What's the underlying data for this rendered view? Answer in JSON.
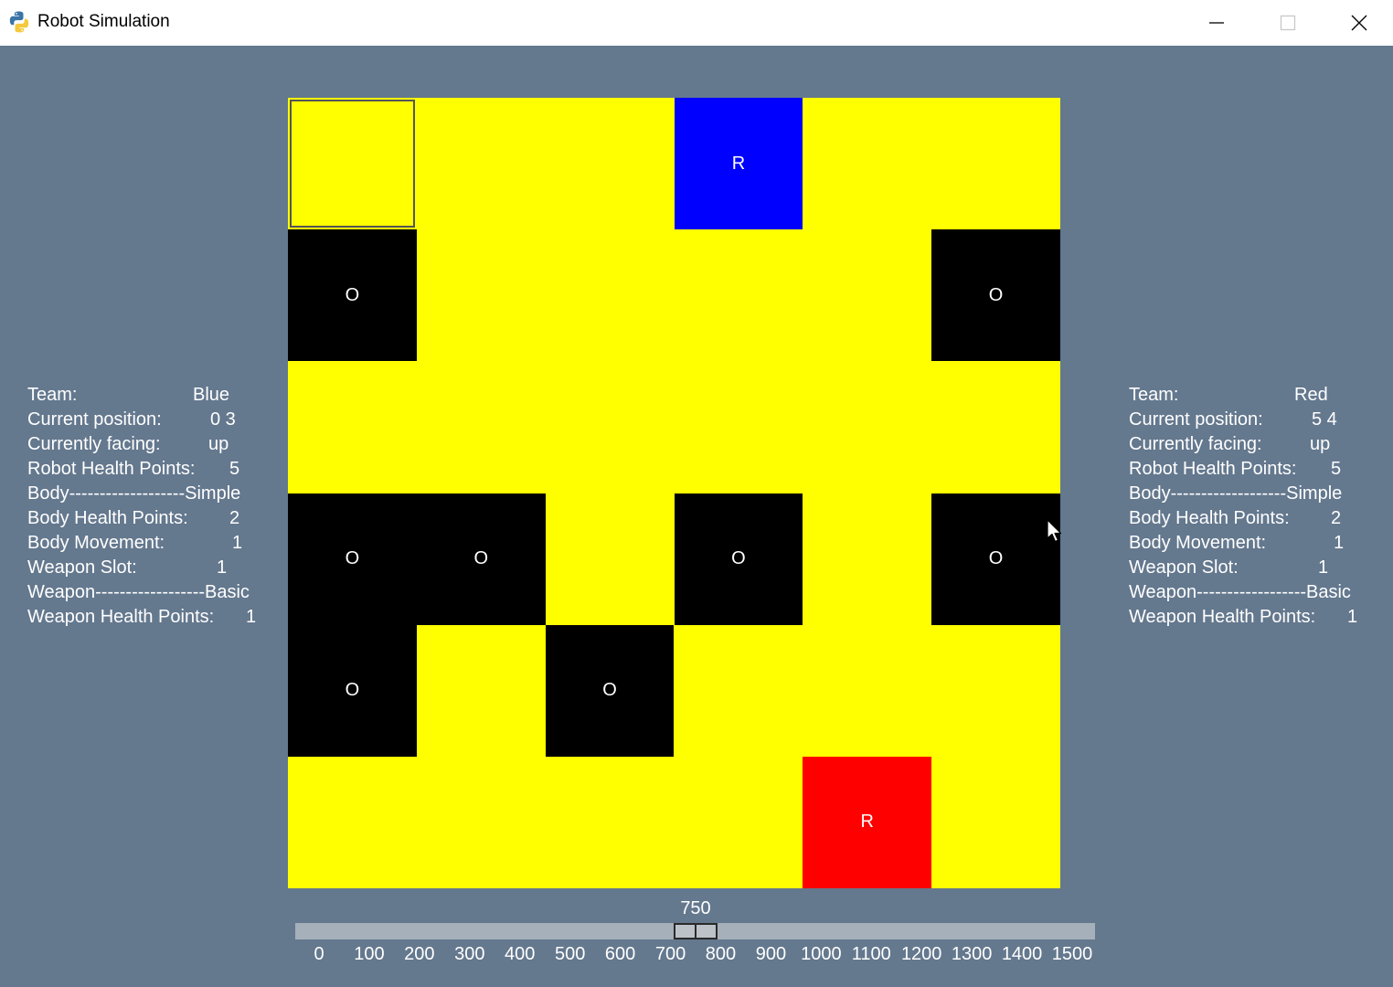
{
  "window": {
    "title": "Robot Simulation",
    "icon": "python-icon",
    "controls": [
      "minimize-icon",
      "maximize-icon",
      "close-icon"
    ]
  },
  "grid": {
    "rows": 6,
    "cols": 6,
    "empty_color": "#ffff00",
    "obstacle_label": "O",
    "robot_label": "R",
    "obstacles": [
      {
        "row": 1,
        "col": 0
      },
      {
        "row": 1,
        "col": 5
      },
      {
        "row": 3,
        "col": 0
      },
      {
        "row": 3,
        "col": 1
      },
      {
        "row": 3,
        "col": 3
      },
      {
        "row": 3,
        "col": 5
      },
      {
        "row": 4,
        "col": 0
      },
      {
        "row": 4,
        "col": 2
      }
    ],
    "robots": [
      {
        "team": "Blue",
        "row": 0,
        "col": 3,
        "color": "#0000ff"
      },
      {
        "team": "Red",
        "row": 5,
        "col": 4,
        "color": "#ff0000"
      }
    ],
    "selected_cell": {
      "row": 0,
      "col": 0
    }
  },
  "left_panel": {
    "team_label": "Team:",
    "team_value": "Blue",
    "position_label": "Current position:",
    "position_value": "0 3",
    "facing_label": "Currently facing:",
    "facing_value": "up",
    "health_label": "Robot Health Points:",
    "health_value": "5",
    "body_label": "Body-------------------Simple",
    "body_health_label": "Body Health Points:",
    "body_health_value": "2",
    "body_movement_label": "Body Movement:",
    "body_movement_value": "1",
    "weapon_slot_label": "Weapon Slot:",
    "weapon_slot_value": "1",
    "weapon_label": "Weapon------------------Basic",
    "weapon_health_label": "Weapon Health Points:",
    "weapon_health_value": "1"
  },
  "right_panel": {
    "team_label": "Team:",
    "team_value": "Red",
    "position_label": "Current position:",
    "position_value": "5 4",
    "facing_label": "Currently facing:",
    "facing_value": "up",
    "health_label": "Robot Health Points:",
    "health_value": "5",
    "body_label": "Body-------------------Simple",
    "body_health_label": "Body Health Points:",
    "body_health_value": "2",
    "body_movement_label": "Body Movement:",
    "body_movement_value": "1",
    "weapon_slot_label": "Weapon Slot:",
    "weapon_slot_value": "1",
    "weapon_label": "Weapon------------------Basic",
    "weapon_health_label": "Weapon Health Points:",
    "weapon_health_value": "1"
  },
  "speed_slider": {
    "value": 750,
    "value_label": "750",
    "min": 0,
    "max": 1500,
    "ticks": [
      "0",
      "100",
      "200",
      "300",
      "400",
      "500",
      "600",
      "700",
      "800",
      "900",
      "1000",
      "1100",
      "1200",
      "1300",
      "1400",
      "1500"
    ]
  }
}
